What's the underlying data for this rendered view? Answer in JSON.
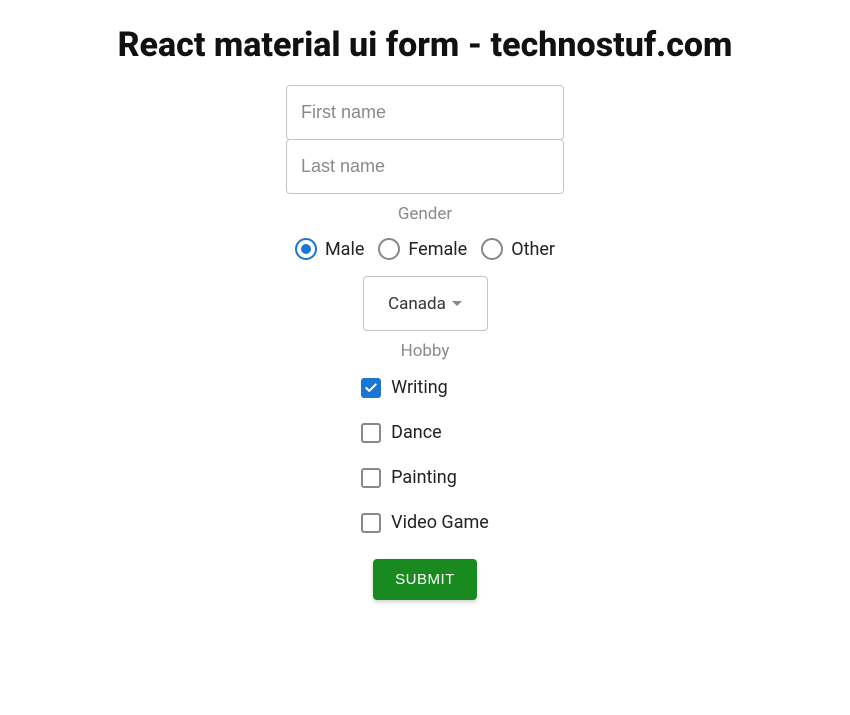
{
  "title": "React material ui form - technostuf.com",
  "form": {
    "first_name": {
      "placeholder": "First name",
      "value": ""
    },
    "last_name": {
      "placeholder": "Last name",
      "value": ""
    },
    "gender": {
      "label": "Gender",
      "options": [
        {
          "label": "Male",
          "selected": true
        },
        {
          "label": "Female",
          "selected": false
        },
        {
          "label": "Other",
          "selected": false
        }
      ]
    },
    "country": {
      "value": "Canada"
    },
    "hobby": {
      "label": "Hobby",
      "options": [
        {
          "label": "Writing",
          "checked": true
        },
        {
          "label": "Dance",
          "checked": false
        },
        {
          "label": "Painting",
          "checked": false
        },
        {
          "label": "Video Game",
          "checked": false
        }
      ]
    },
    "submit_label": "SUBMIT"
  },
  "colors": {
    "primary": "#1976d2",
    "success": "#198a1f"
  }
}
